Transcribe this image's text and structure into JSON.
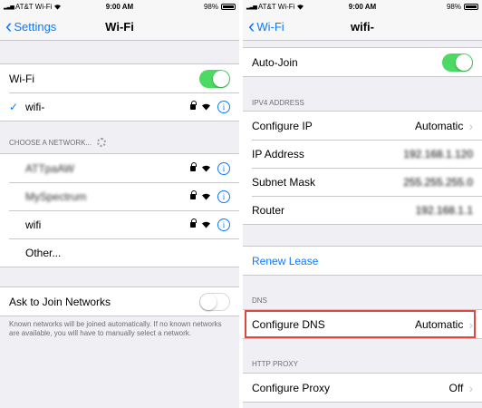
{
  "left": {
    "status": {
      "carrier": "AT&T Wi-Fi",
      "time": "9:00 AM",
      "battery": "98%"
    },
    "nav": {
      "back": "Settings",
      "title": "Wi-Fi"
    },
    "wifi_row": {
      "label": "Wi-Fi",
      "toggle_state": "on"
    },
    "connected": {
      "name": "wifi-",
      "check": "✓"
    },
    "choose_header": "CHOOSE A NETWORK...",
    "networks": [
      {
        "name": "ATTpaAW",
        "blurred": true
      },
      {
        "name": "MySpectrum",
        "blurred": true
      },
      {
        "name": "wifi",
        "blurred": false
      }
    ],
    "other": "Other...",
    "ask_join": {
      "label": "Ask to Join Networks",
      "toggle_state": "off"
    },
    "footer": "Known networks will be joined automatically. If no known networks are available, you will have to manually select a network."
  },
  "right": {
    "status": {
      "carrier": "AT&T Wi-Fi",
      "time": "9:00 AM",
      "battery": "98%"
    },
    "nav": {
      "back": "Wi-Fi",
      "title": "wifi-"
    },
    "auto_join": {
      "label": "Auto-Join",
      "toggle_state": "on"
    },
    "ipv4_header": "IPV4 ADDRESS",
    "ipv4_rows": [
      {
        "label": "Configure IP",
        "value": "Automatic",
        "chevron": true,
        "blurred": false
      },
      {
        "label": "IP Address",
        "value": "192.168.1.120",
        "chevron": false,
        "blurred": true
      },
      {
        "label": "Subnet Mask",
        "value": "255.255.255.0",
        "chevron": false,
        "blurred": true
      },
      {
        "label": "Router",
        "value": "192.168.1.1",
        "chevron": false,
        "blurred": true
      }
    ],
    "renew": "Renew Lease",
    "dns_header": "DNS",
    "dns": {
      "label": "Configure DNS",
      "value": "Automatic"
    },
    "proxy_header": "HTTP PROXY",
    "proxy": {
      "label": "Configure Proxy",
      "value": "Off"
    }
  },
  "colors": {
    "accent": "#0a7aff",
    "toggle_on": "#4cd964",
    "highlight": "#e0483e",
    "background": "#efeff4"
  }
}
